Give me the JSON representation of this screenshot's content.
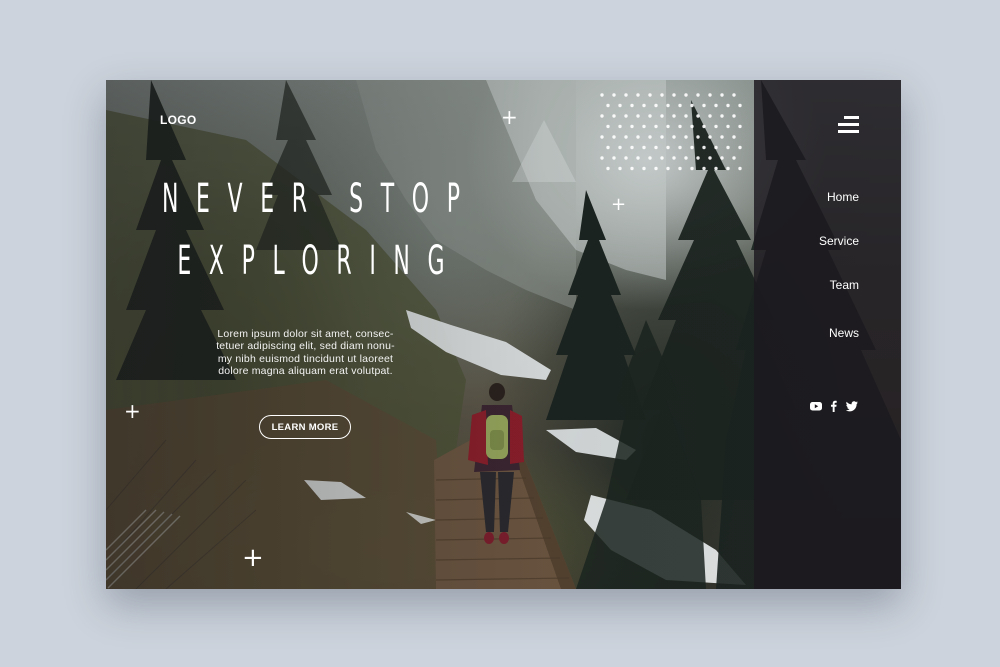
{
  "brand": {
    "logo": "LOGO"
  },
  "hero": {
    "headline_line1": "NEVER STOP",
    "headline_line2": "EXPLORING",
    "body_lines": [
      "Lorem ipsum dolor sit amet, consec-",
      "tetuer adipiscing elit, sed diam nonu-",
      "my nibh euismod tincidunt ut laoreet",
      "dolore magna aliquam erat volutpat."
    ],
    "cta_label": "LEARN MORE"
  },
  "nav": {
    "items": [
      {
        "label": "Home"
      },
      {
        "label": "Service"
      },
      {
        "label": "Team"
      },
      {
        "label": "News"
      }
    ]
  },
  "social": [
    "youtube-icon",
    "facebook-icon",
    "twitter-icon"
  ],
  "decorations": {
    "plus_glyph": "+"
  },
  "colors": {
    "page_background": "#ccd3dc",
    "side_panel": "#1c181e",
    "text": "#ffffff"
  }
}
